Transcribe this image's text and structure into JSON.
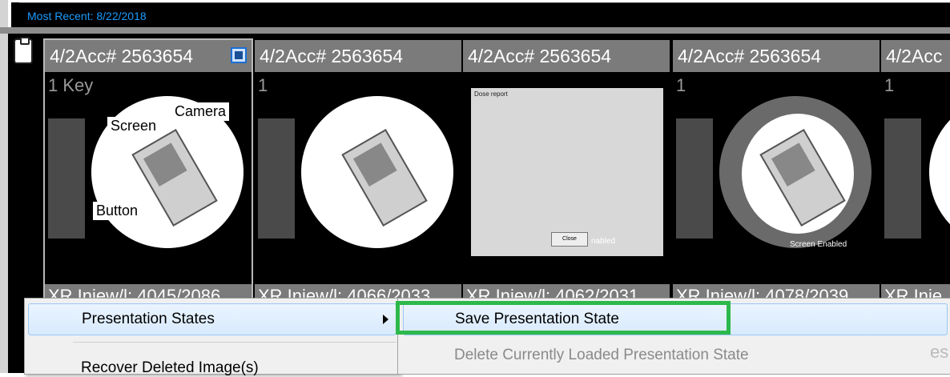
{
  "header": {
    "title": "Most Recent: 8/22/2018"
  },
  "thumbnails": [
    {
      "title": "4/2Acc# 2563654",
      "footer": "XR Iniew/l: 4045/2086",
      "overlay": "1 Key",
      "selected": true
    },
    {
      "title": "4/2Acc# 2563654",
      "footer": "XR Iniew/l: 4066/2033",
      "overlay": "1"
    },
    {
      "title": "4/2Acc# 2563654",
      "footer": "XR Iniew/l: 4062/2031",
      "overlay": ""
    },
    {
      "title": "4/2Acc# 2563654",
      "footer": "XR Iniew/l: 4078/2039",
      "overlay": "1"
    },
    {
      "title": "4/2Acc",
      "footer": "XR Inje",
      "overlay": "1"
    }
  ],
  "annotations": {
    "camera": "Camera",
    "screen": "Screen",
    "button": "Button"
  },
  "report": {
    "title": "Dose report",
    "ok": "Close",
    "enabled_caption": "nabled"
  },
  "thumb4_caption": "Screen Enabled",
  "context_menu": {
    "item1": "Presentation States",
    "item2": "Recover Deleted Image(s)"
  },
  "submenu": {
    "item1": "Save Presentation State",
    "item2": "Delete Currently Loaded Presentation State"
  },
  "right_clip": "es"
}
